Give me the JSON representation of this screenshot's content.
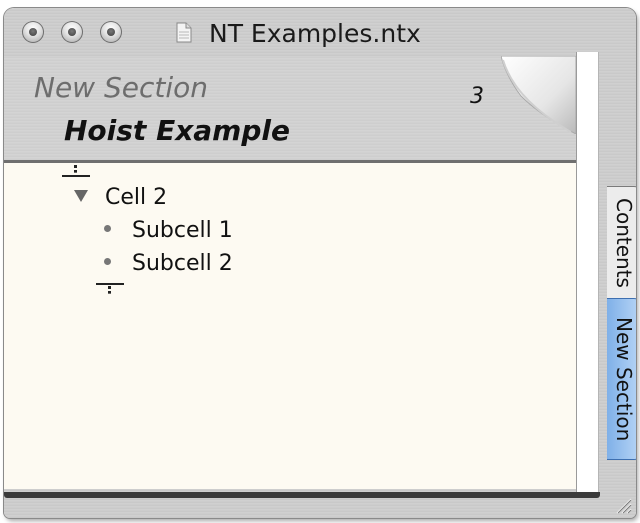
{
  "window": {
    "title": "NT Examples.ntx",
    "icons": {
      "close": "close-button",
      "minimize": "minimize-button",
      "zoom": "zoom-button",
      "document": "document-icon"
    }
  },
  "header": {
    "section_title": "New Section",
    "page_title": "Hoist Example",
    "page_number": "3"
  },
  "outline": {
    "items": [
      {
        "label": "Cell 2",
        "level": 0,
        "expanded": true
      },
      {
        "label": "Subcell 1",
        "level": 1
      },
      {
        "label": "Subcell 2",
        "level": 1
      }
    ]
  },
  "tabs": [
    {
      "label": "Contents",
      "selected": false
    },
    {
      "label": "New Section",
      "selected": true
    }
  ],
  "colors": {
    "content_bg": "#fdfaf2",
    "selected_tab": "#7fb0e8"
  }
}
